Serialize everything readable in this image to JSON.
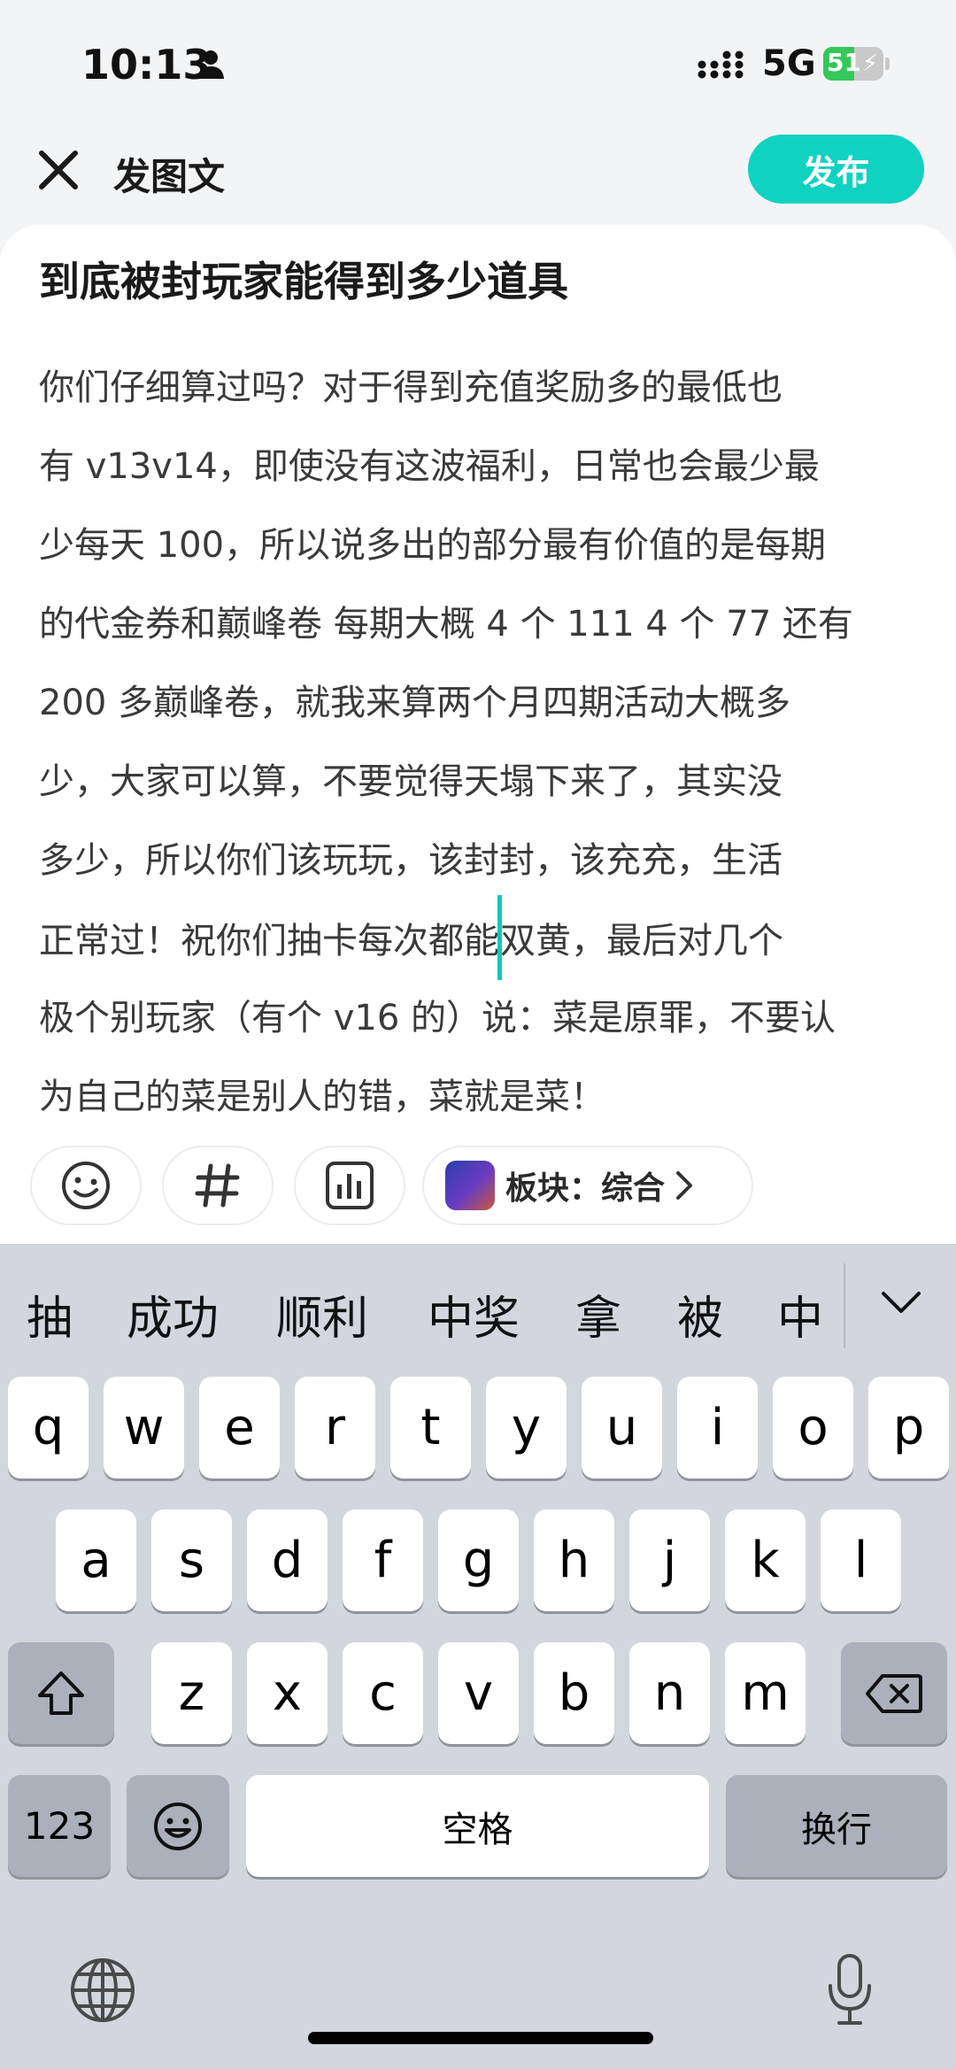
{
  "status_bar": {
    "time": "10:13",
    "network": "5G",
    "battery_label": "51",
    "battery_level_percent": 51,
    "icons": [
      "person-icon",
      "signal-icon",
      "battery-icon"
    ]
  },
  "header": {
    "title": "发图文",
    "publish_label": "发布",
    "accent_color": "#10d2c1"
  },
  "post": {
    "title": "到底被封玩家能得到多少道具",
    "body_lines": [
      "你们仔细算过吗？对于得到充值奖励多的最低也",
      "有 v13v14，即使没有这波福利，日常也会最少最",
      "少每天 100，所以说多出的部分最有价值的是每期",
      "的代金券和巅峰卷 每期大概 4 个 111 4 个 77 还有",
      "200 多巅峰卷，就我来算两个月四期活动大概多",
      "少，大家可以算，不要觉得天塌下来了，其实没",
      "多少，所以你们该玩玩，该封封，该充充，生活",
      "正常过！祝你们抽卡每次都能",
      "双黄，最后对几个",
      "极个别玩家（有个 v16 的）说：菜是原罪，不要认",
      "为自己的菜是别人的错，菜就是菜！"
    ]
  },
  "toolbar": {
    "section_label": "板块：综合",
    "icons": [
      "emoji-icon",
      "hashtag-icon",
      "chart-icon",
      "chevron-right-icon"
    ]
  },
  "keyboard": {
    "candidates": [
      "抽",
      "成功",
      "顺利",
      "中奖",
      "拿",
      "被",
      "中"
    ],
    "row1": [
      "q",
      "w",
      "e",
      "r",
      "t",
      "y",
      "u",
      "i",
      "o",
      "p"
    ],
    "row2": [
      "a",
      "s",
      "d",
      "f",
      "g",
      "h",
      "j",
      "k",
      "l"
    ],
    "row3": [
      "z",
      "x",
      "c",
      "v",
      "b",
      "n",
      "m"
    ],
    "numbers_label": "123",
    "space_label": "空格",
    "return_label": "换行"
  }
}
